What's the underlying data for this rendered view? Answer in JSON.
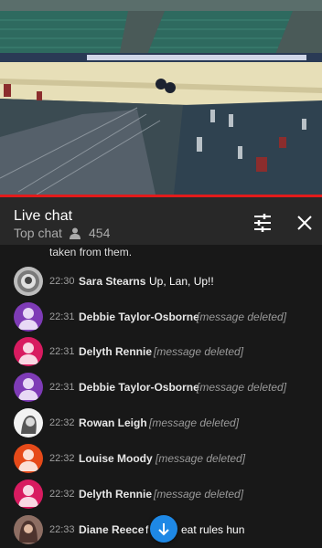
{
  "chat": {
    "title": "Live chat",
    "mode": "Top chat",
    "viewer_count": "454"
  },
  "partial_message": "taken from them.",
  "messages": [
    {
      "time": "22:30",
      "author": "Sara Stearns",
      "text": "Up, Lan, Up!!",
      "deleted": false,
      "avatar_color": "#cfcfcf"
    },
    {
      "time": "22:31",
      "author": "Debbie Taylor-Osborne",
      "text": "[message deleted]",
      "deleted": true,
      "avatar_color": "#7e3bb6"
    },
    {
      "time": "22:31",
      "author": "Delyth Rennie",
      "text": "[message deleted]",
      "deleted": true,
      "avatar_color": "#d81b60"
    },
    {
      "time": "22:31",
      "author": "Debbie Taylor-Osborne",
      "text": "[message deleted]",
      "deleted": true,
      "avatar_color": "#7e3bb6"
    },
    {
      "time": "22:32",
      "author": "Rowan Leigh",
      "text": "[message deleted]",
      "deleted": true,
      "avatar_color": "#e8e8e8"
    },
    {
      "time": "22:32",
      "author": "Louise Moody",
      "text": "[message deleted]",
      "deleted": true,
      "avatar_color": "#e64a19"
    },
    {
      "time": "22:32",
      "author": "Delyth Rennie",
      "text": "[message deleted]",
      "deleted": true,
      "avatar_color": "#d81b60"
    },
    {
      "time": "22:33",
      "author": "Diane Reece",
      "text": "f",
      "deleted": false,
      "avatar_color": "#8d6e63"
    }
  ],
  "last_text_tail": "eat rules hun",
  "colors": {
    "progress": "#e21b1b",
    "accent_button": "#1e88e5"
  },
  "icons": {
    "viewers": "person-icon",
    "settings": "sliders-icon",
    "close": "close-icon",
    "scroll": "arrow-down-icon"
  }
}
